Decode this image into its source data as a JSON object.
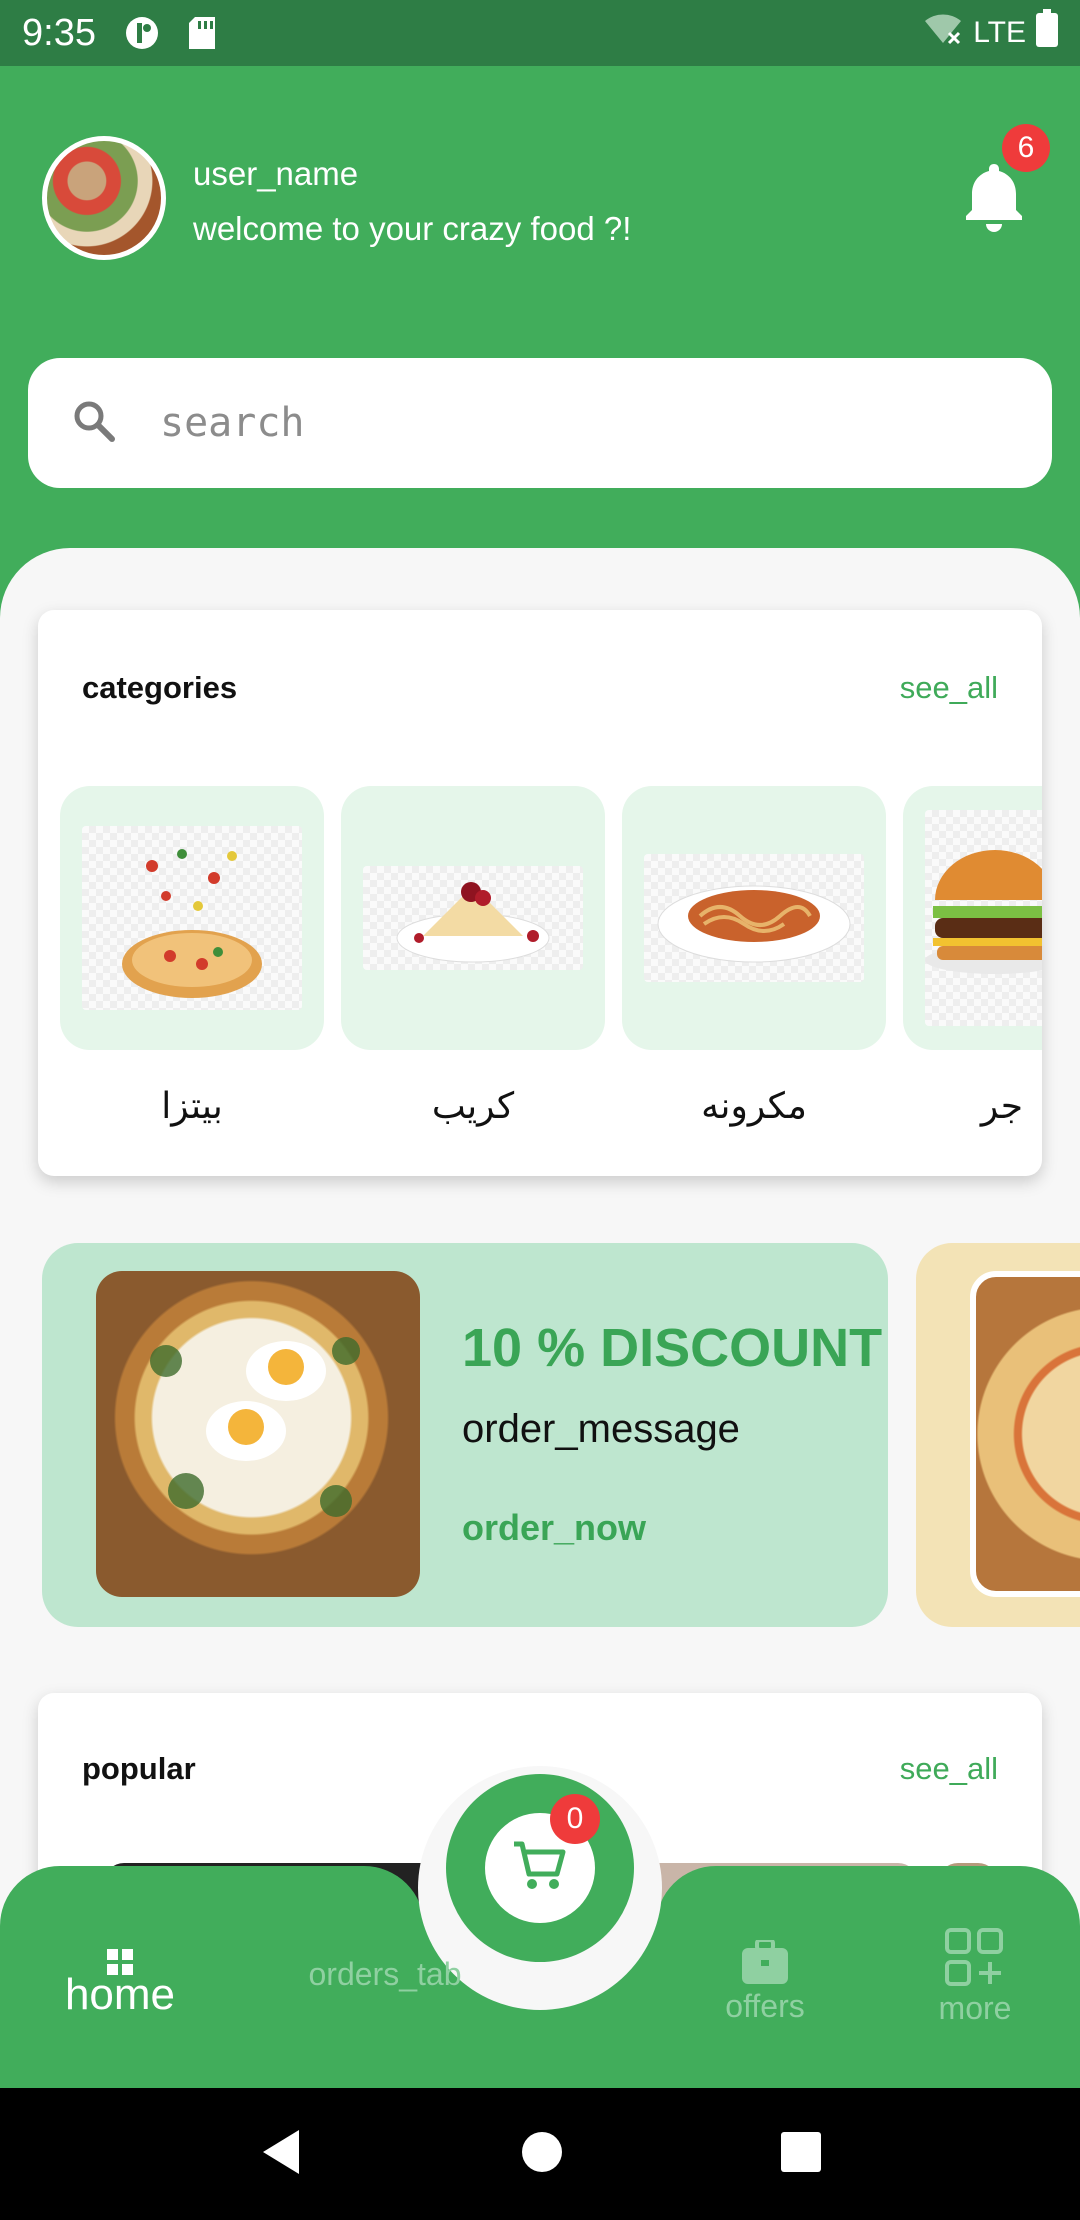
{
  "status_bar": {
    "time": "9:35",
    "network": "LTE"
  },
  "header": {
    "user_name": "user_name",
    "welcome": "welcome to your crazy food ?!",
    "notification_count": "6"
  },
  "search": {
    "placeholder": "search"
  },
  "categories": {
    "title": "categories",
    "see_all": "see_all",
    "items": [
      {
        "label": "بيتزا",
        "icon": "pizza-image"
      },
      {
        "label": "كريب",
        "icon": "crepe-image"
      },
      {
        "label": "مكرونه",
        "icon": "pasta-image"
      },
      {
        "label": "جر",
        "icon": "burger-image"
      }
    ]
  },
  "promo": {
    "title": "10 % DISCOUNT",
    "message": "order_message",
    "cta": "order_now"
  },
  "popular": {
    "title": "popular",
    "see_all": "see_all"
  },
  "cart": {
    "count": "0"
  },
  "bottom_nav": {
    "home": "home",
    "orders": "orders_tab",
    "offers": "offers",
    "more": "more"
  },
  "colors": {
    "primary": "#41ad5b",
    "badge": "#ef3b3b",
    "tile": "#e5f6ea",
    "promo_bg": "#bee6cf"
  }
}
